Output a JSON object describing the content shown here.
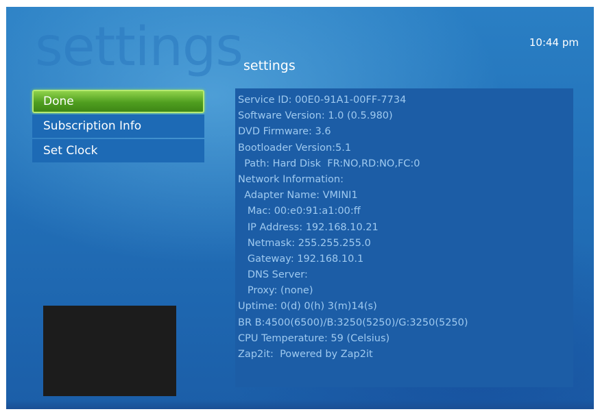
{
  "header": {
    "watermark": "settings",
    "title": "settings",
    "clock": "10:44 pm"
  },
  "menu": {
    "items": [
      {
        "label": "Done",
        "selected": true
      },
      {
        "label": "Subscription Info",
        "selected": false
      },
      {
        "label": "Set Clock",
        "selected": false
      }
    ]
  },
  "info": {
    "lines": [
      "Service ID: 00E0-91A1-00FF-7734",
      "Software Version: 1.0 (0.5.980)",
      "DVD Firmware: 3.6",
      "Bootloader Version:5.1",
      "  Path: Hard Disk  FR:NO,RD:NO,FC:0",
      "Network Information:",
      "  Adapter Name: VMINI1",
      "   Mac: 00:e0:91:a1:00:ff",
      "   IP Address: 192.168.10.21",
      "   Netmask: 255.255.255.0",
      "   Gateway: 192.168.10.1",
      "   DNS Server:",
      "   Proxy: (none)",
      "Uptime: 0(d) 0(h) 3(m)14(s)",
      "BR B:4500(6500)/B:3250(5250)/G:3250(5250)",
      "CPU Temperature: 59 (Celsius)",
      "Zap2it:  Powered by Zap2it"
    ]
  },
  "colors": {
    "background": "#2270b8",
    "panel": "#1c5da6",
    "info_text": "#9fcaf0",
    "selected_item": "#4f9e1f"
  }
}
